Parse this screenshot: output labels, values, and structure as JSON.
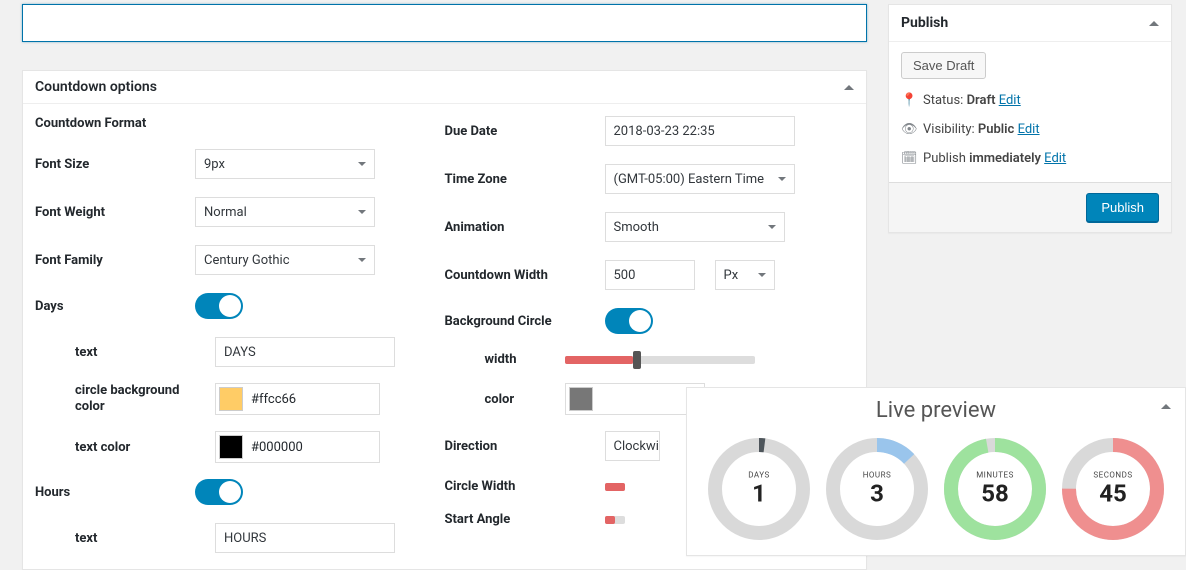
{
  "title_input": {
    "value": ""
  },
  "options": {
    "title": "Countdown options",
    "left": {
      "format_label": "Countdown Format",
      "font_size": {
        "label": "Font Size",
        "value": "9px"
      },
      "font_weight": {
        "label": "Font Weight",
        "value": "Normal"
      },
      "font_family": {
        "label": "Font Family",
        "value": "Century Gothic"
      },
      "days": {
        "label": "Days",
        "text": {
          "label": "text",
          "value": "DAYS"
        },
        "bg": {
          "label": "circle background color",
          "value": "#ffcc66",
          "swatch": "#ffcc66"
        },
        "textcolor": {
          "label": "text color",
          "value": "#000000",
          "swatch": "#000000"
        }
      },
      "hours": {
        "label": "Hours",
        "text": {
          "label": "text",
          "value": "HOURS"
        }
      }
    },
    "right": {
      "due_date": {
        "label": "Due Date",
        "value": "2018-03-23 22:35"
      },
      "timezone": {
        "label": "Time Zone",
        "value": "(GMT-05:00) Eastern Time"
      },
      "animation": {
        "label": "Animation",
        "value": "Smooth"
      },
      "width": {
        "label": "Countdown Width",
        "value": "500",
        "unit": "Px"
      },
      "bg_circle": {
        "label": "Background Circle",
        "width": {
          "label": "width",
          "fill_pct": 36
        },
        "color": {
          "label": "color",
          "swatch": "#777777"
        }
      },
      "direction": {
        "label": "Direction",
        "value": "Clockwi"
      },
      "circle_width": {
        "label": "Circle Width"
      },
      "start_angle": {
        "label": "Start Angle"
      }
    }
  },
  "publish": {
    "title": "Publish",
    "save_draft": "Save Draft",
    "status": {
      "label": "Status:",
      "value": "Draft",
      "edit": "Edit"
    },
    "visibility": {
      "label": "Visibility:",
      "value": "Public",
      "edit": "Edit"
    },
    "schedule": {
      "label": "Publish",
      "value": "immediately",
      "edit": "Edit"
    },
    "button": "Publish"
  },
  "preview": {
    "title": "Live preview",
    "items": [
      {
        "label": "DAYS",
        "value": "1",
        "ring_color": "#4e555b",
        "frac": 0.02
      },
      {
        "label": "HOURS",
        "value": "3",
        "ring_color": "#9ac5ec",
        "frac": 0.13
      },
      {
        "label": "MINUTES",
        "value": "58",
        "ring_color": "#9ee29e",
        "frac": 0.97
      },
      {
        "label": "SECONDS",
        "value": "45",
        "ring_color": "#ef8f8f",
        "frac": 0.75
      }
    ]
  }
}
